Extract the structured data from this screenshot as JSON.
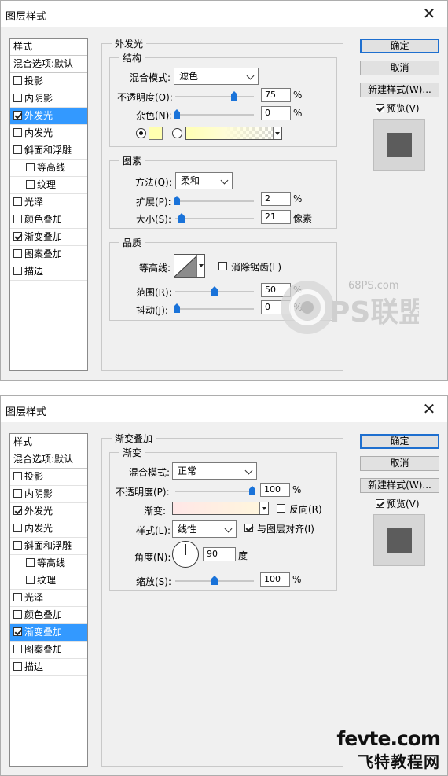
{
  "dialogs": [
    {
      "title": "图层样式",
      "style_list": {
        "header": "样式",
        "blend_options": "混合选项:默认",
        "items": [
          {
            "label": "投影",
            "checked": false,
            "selected": false,
            "indent": false
          },
          {
            "label": "内阴影",
            "checked": false,
            "selected": false,
            "indent": false
          },
          {
            "label": "外发光",
            "checked": true,
            "selected": true,
            "indent": false
          },
          {
            "label": "内发光",
            "checked": false,
            "selected": false,
            "indent": false
          },
          {
            "label": "斜面和浮雕",
            "checked": false,
            "selected": false,
            "indent": false
          },
          {
            "label": "等高线",
            "checked": false,
            "selected": false,
            "indent": true
          },
          {
            "label": "纹理",
            "checked": false,
            "selected": false,
            "indent": true
          },
          {
            "label": "光泽",
            "checked": false,
            "selected": false,
            "indent": false
          },
          {
            "label": "颜色叠加",
            "checked": false,
            "selected": false,
            "indent": false
          },
          {
            "label": "渐变叠加",
            "checked": true,
            "selected": false,
            "indent": false
          },
          {
            "label": "图案叠加",
            "checked": false,
            "selected": false,
            "indent": false
          },
          {
            "label": "描边",
            "checked": false,
            "selected": false,
            "indent": false
          }
        ]
      },
      "panel": {
        "title": "外发光",
        "structure": {
          "title": "结构",
          "blend_mode_label": "混合模式:",
          "blend_mode_value": "滤色",
          "opacity_label": "不透明度(O):",
          "opacity_value": "75",
          "opacity_level": 75,
          "noise_label": "杂色(N):",
          "noise_value": "0",
          "noise_level": 0,
          "unit": "%",
          "glow_color": "#ffffb0"
        },
        "elements": {
          "title": "图素",
          "method_label": "方法(Q):",
          "method_value": "柔和",
          "spread_label": "扩展(P):",
          "spread_value": "2",
          "spread_level": 2,
          "size_label": "大小(S):",
          "size_value": "21",
          "size_level": 8.4,
          "unit_percent": "%",
          "unit_pixels": "像素"
        },
        "quality": {
          "title": "品质",
          "contour_label": "等高线:",
          "antialias_label": "消除锯齿(L)",
          "range_label": "范围(R):",
          "range_value": "50",
          "range_level": 50,
          "jitter_label": "抖动(J):",
          "jitter_value": "0",
          "jitter_level": 0,
          "unit": "%"
        }
      },
      "buttons": {
        "ok": "确定",
        "cancel": "取消",
        "new_style": "新建样式(W)...",
        "preview": "预览(V)"
      }
    },
    {
      "title": "图层样式",
      "style_list": {
        "header": "样式",
        "blend_options": "混合选项:默认",
        "items": [
          {
            "label": "投影",
            "checked": false,
            "selected": false,
            "indent": false
          },
          {
            "label": "内阴影",
            "checked": false,
            "selected": false,
            "indent": false
          },
          {
            "label": "外发光",
            "checked": true,
            "selected": false,
            "indent": false
          },
          {
            "label": "内发光",
            "checked": false,
            "selected": false,
            "indent": false
          },
          {
            "label": "斜面和浮雕",
            "checked": false,
            "selected": false,
            "indent": false
          },
          {
            "label": "等高线",
            "checked": false,
            "selected": false,
            "indent": true
          },
          {
            "label": "纹理",
            "checked": false,
            "selected": false,
            "indent": true
          },
          {
            "label": "光泽",
            "checked": false,
            "selected": false,
            "indent": false
          },
          {
            "label": "颜色叠加",
            "checked": false,
            "selected": false,
            "indent": false
          },
          {
            "label": "渐变叠加",
            "checked": true,
            "selected": true,
            "indent": false
          },
          {
            "label": "图案叠加",
            "checked": false,
            "selected": false,
            "indent": false
          },
          {
            "label": "描边",
            "checked": false,
            "selected": false,
            "indent": false
          }
        ]
      },
      "panel": {
        "title": "渐变叠加",
        "gradient": {
          "title": "渐变",
          "blend_mode_label": "混合模式:",
          "blend_mode_value": "正常",
          "opacity_label": "不透明度(P):",
          "opacity_value": "100",
          "opacity_level": 100,
          "gradient_label": "渐变:",
          "reverse_label": "反向(R)",
          "style_label": "样式(L):",
          "style_value": "线性",
          "align_label": "与图层对齐(I)",
          "angle_label": "角度(N):",
          "angle_value": "90",
          "angle_unit": "度",
          "scale_label": "缩放(S):",
          "scale_value": "100",
          "scale_level": 50,
          "unit": "%"
        }
      },
      "buttons": {
        "ok": "确定",
        "cancel": "取消",
        "new_style": "新建样式(W)...",
        "preview": "预览(V)"
      }
    }
  ],
  "watermarks": {
    "ps_site": "68PS.com",
    "ps_brand": "PS联盟",
    "fevte_site": "fevte.com",
    "fevte_brand": "飞特教程网"
  },
  "colors": {
    "selection": "#3399ff",
    "slider": "#1a73d9",
    "dialog_bg": "#f0f0f0"
  }
}
